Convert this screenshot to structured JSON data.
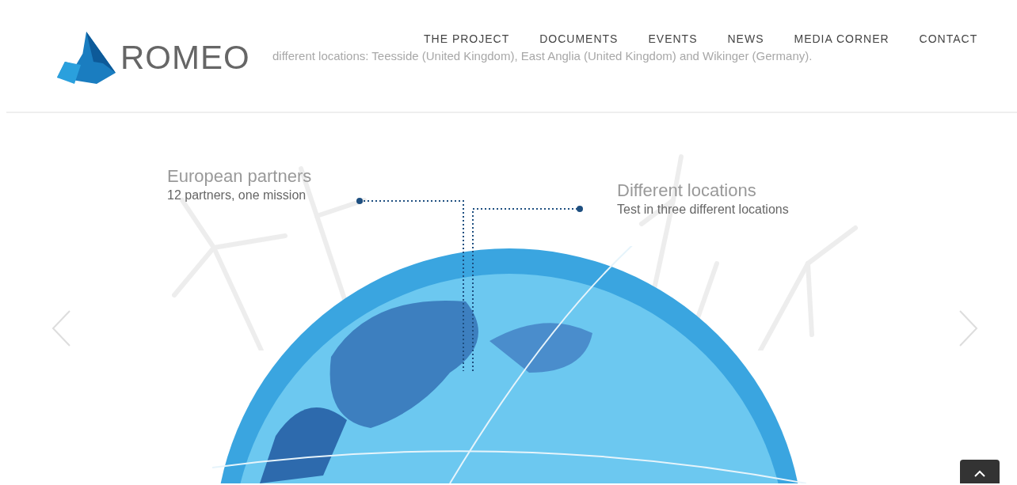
{
  "header": {
    "logo_text": "ROMEO",
    "ghost_caption": "different locations: Teesside (United Kingdom), East Anglia (United Kingdom) and Wikinger (Germany).",
    "nav": [
      {
        "label": "THE PROJECT"
      },
      {
        "label": "DOCUMENTS"
      },
      {
        "label": "EVENTS"
      },
      {
        "label": "NEWS"
      },
      {
        "label": "MEDIA CORNER"
      },
      {
        "label": "CONTACT"
      }
    ]
  },
  "slide": {
    "callouts": [
      {
        "title": "European partners",
        "subtitle": "12 partners, one mission"
      },
      {
        "title": "Different locations",
        "subtitle": "Test in three different locations"
      }
    ]
  }
}
